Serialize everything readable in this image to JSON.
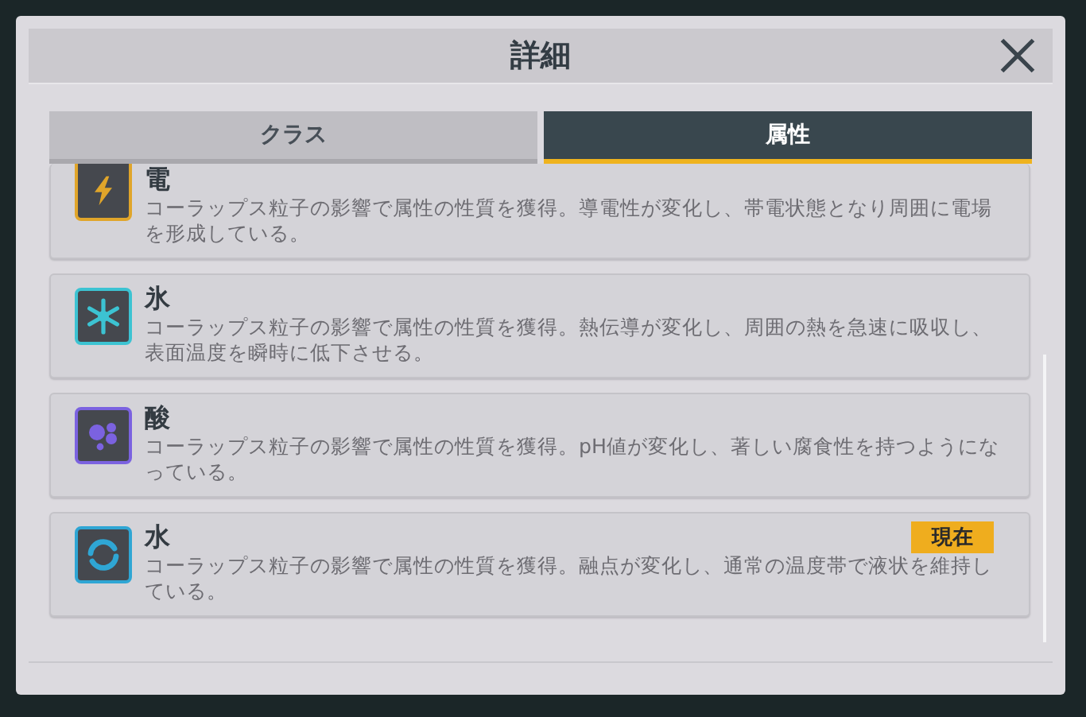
{
  "dialog": {
    "title": "詳細"
  },
  "tabs": [
    {
      "label": "クラス",
      "selected": false
    },
    {
      "label": "属性",
      "selected": true
    }
  ],
  "attributes": [
    {
      "kind": "electric",
      "color": "#e0a52a",
      "name": "電",
      "description": "コーラップス粒子の影響で属性の性質を獲得。導電性が変化し、帯電状態となり周囲に電場を形成している。",
      "current": false
    },
    {
      "kind": "ice",
      "color": "#3cc3d2",
      "name": "氷",
      "description": "コーラップス粒子の影響で属性の性質を獲得。熱伝導が変化し、周囲の熱を急速に吸収し、表面温度を瞬時に低下させる。",
      "current": false
    },
    {
      "kind": "acid",
      "color": "#7b62e0",
      "name": "酸",
      "description": "コーラップス粒子の影響で属性の性質を獲得。pH値が変化し、著しい腐食性を持つようになっている。",
      "current": false
    },
    {
      "kind": "water",
      "color": "#2fa6d4",
      "name": "水",
      "description": "コーラップス粒子の影響で属性の性質を獲得。融点が変化し、通常の温度帯で液状を維持している。",
      "current": true,
      "badge": "現在"
    }
  ]
}
